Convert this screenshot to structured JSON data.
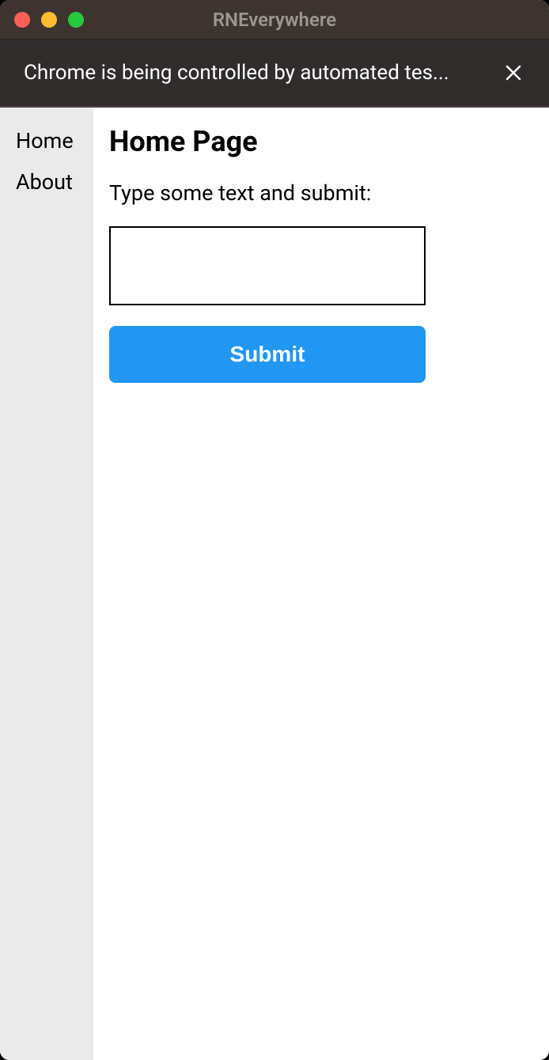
{
  "window": {
    "title": "RNEverywhere"
  },
  "infoBar": {
    "message": "Chrome is being controlled by automated tes..."
  },
  "sidebar": {
    "items": [
      {
        "label": "Home"
      },
      {
        "label": "About"
      }
    ]
  },
  "main": {
    "title": "Home Page",
    "form": {
      "label": "Type some text and submit:",
      "inputValue": "",
      "submitLabel": "Submit"
    }
  }
}
